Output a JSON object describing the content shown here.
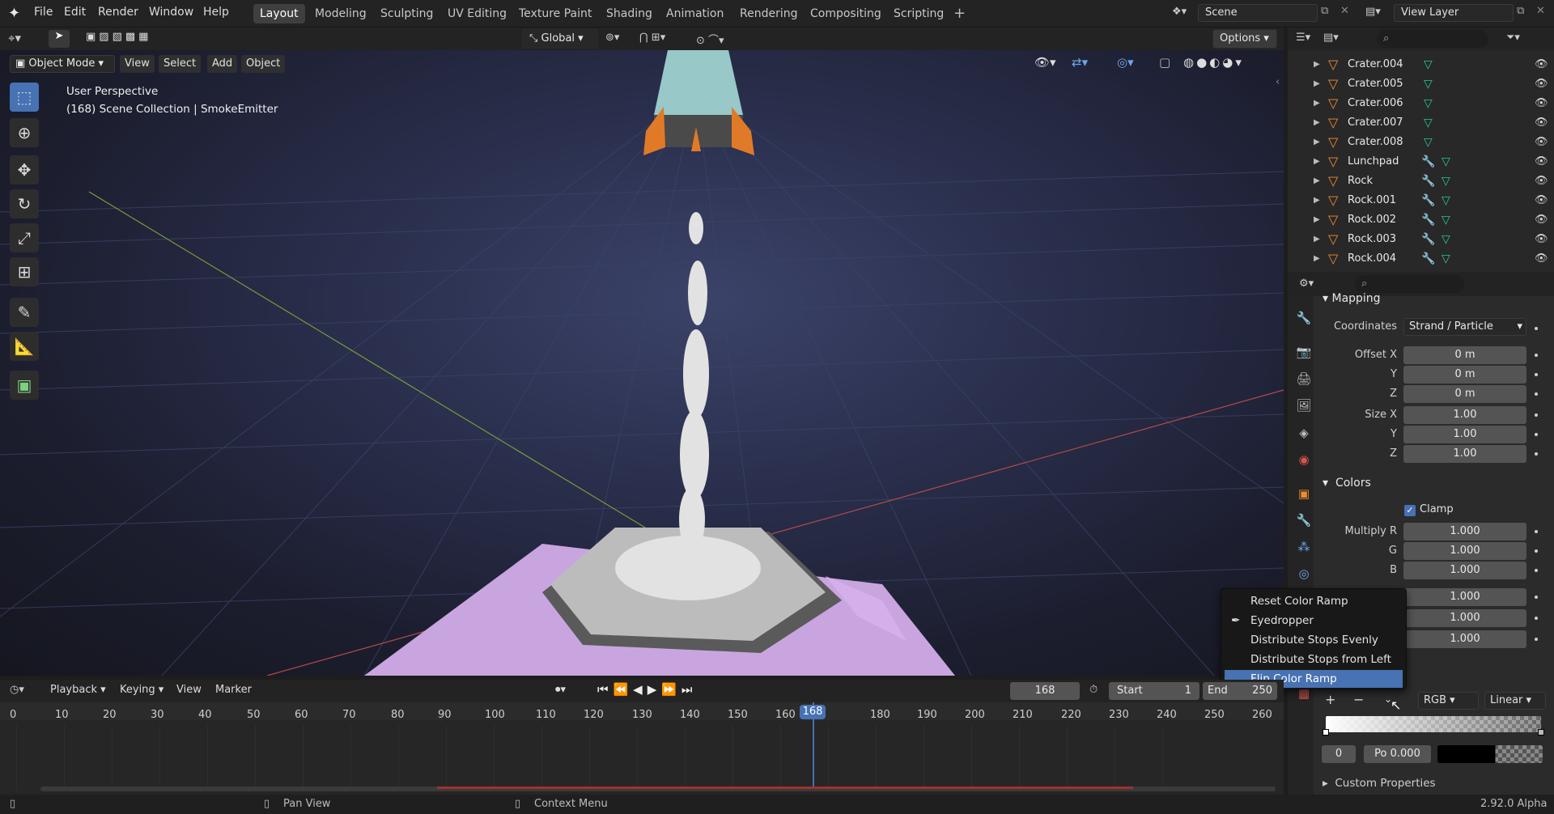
{
  "app": {
    "version": "2.92.0 Alpha"
  },
  "menu": [
    "File",
    "Edit",
    "Render",
    "Window",
    "Help"
  ],
  "workspaces": {
    "active": "Layout",
    "tabs": [
      "Layout",
      "Modeling",
      "Sculpting",
      "UV Editing",
      "Texture Paint",
      "Shading",
      "Animation",
      "Rendering",
      "Compositing",
      "Scripting"
    ]
  },
  "scene": {
    "name": "Scene",
    "view_layer": "View Layer"
  },
  "viewport": {
    "mode": "Object Mode",
    "menus": [
      "View",
      "Select",
      "Add",
      "Object"
    ],
    "orientation": "Global",
    "options_label": "Options",
    "overlay_line1": "User Perspective",
    "overlay_line2": "(168) Scene Collection | SmokeEmitter"
  },
  "outliner": {
    "items": [
      {
        "name": "Crater.004",
        "modifier": false
      },
      {
        "name": "Crater.005",
        "modifier": false
      },
      {
        "name": "Crater.006",
        "modifier": false
      },
      {
        "name": "Crater.007",
        "modifier": false
      },
      {
        "name": "Crater.008",
        "modifier": false
      },
      {
        "name": "Lunchpad",
        "modifier": true
      },
      {
        "name": "Rock",
        "modifier": true
      },
      {
        "name": "Rock.001",
        "modifier": true
      },
      {
        "name": "Rock.002",
        "modifier": true
      },
      {
        "name": "Rock.003",
        "modifier": true
      },
      {
        "name": "Rock.004",
        "modifier": true
      }
    ]
  },
  "properties": {
    "mapping_section": "Mapping",
    "coordinates_label": "Coordinates",
    "coordinates_value": "Strand / Particle",
    "offset": [
      {
        "label": "Offset X",
        "value": "0 m"
      },
      {
        "label": "Y",
        "value": "0 m"
      },
      {
        "label": "Z",
        "value": "0 m"
      }
    ],
    "size": [
      {
        "label": "Size X",
        "value": "1.00"
      },
      {
        "label": "Y",
        "value": "1.00"
      },
      {
        "label": "Z",
        "value": "1.00"
      }
    ],
    "colors_section": "Colors",
    "clamp_label": "Clamp",
    "multiply": [
      {
        "label": "Multiply R",
        "value": "1.000"
      },
      {
        "label": "G",
        "value": "1.000"
      },
      {
        "label": "B",
        "value": "1.000"
      }
    ],
    "extra_values": [
      "1.000",
      "1.000",
      "1.000"
    ],
    "ramp_color_mode": "RGB",
    "ramp_interp": "Linear",
    "stop_index": "0",
    "stop_pos": "Po 0.000",
    "custom_props": "Custom Properties"
  },
  "context_menu": {
    "items": [
      {
        "label": "Reset Color Ramp",
        "icon": "",
        "highlight": false
      },
      {
        "label": "Eyedropper",
        "icon": "eyedropper-icon",
        "highlight": false
      },
      {
        "label": "Distribute Stops Evenly",
        "icon": "",
        "highlight": false
      },
      {
        "label": "Distribute Stops from Left",
        "icon": "",
        "highlight": false
      },
      {
        "label": "Flip Color Ramp",
        "icon": "",
        "highlight": true
      }
    ]
  },
  "timeline": {
    "menus": [
      "Playback",
      "Keying",
      "View",
      "Marker"
    ],
    "current_frame": "168",
    "start_label": "Start",
    "start_value": "1",
    "end_label": "End",
    "end_value": "250",
    "ruler": [
      "0",
      "10",
      "20",
      "30",
      "40",
      "50",
      "60",
      "70",
      "80",
      "90",
      "100",
      "110",
      "120",
      "130",
      "140",
      "150",
      "160",
      "180",
      "190",
      "200",
      "210",
      "220",
      "230",
      "240",
      "250",
      "260"
    ]
  },
  "status": {
    "pan": "Pan View",
    "context": "Context Menu"
  }
}
